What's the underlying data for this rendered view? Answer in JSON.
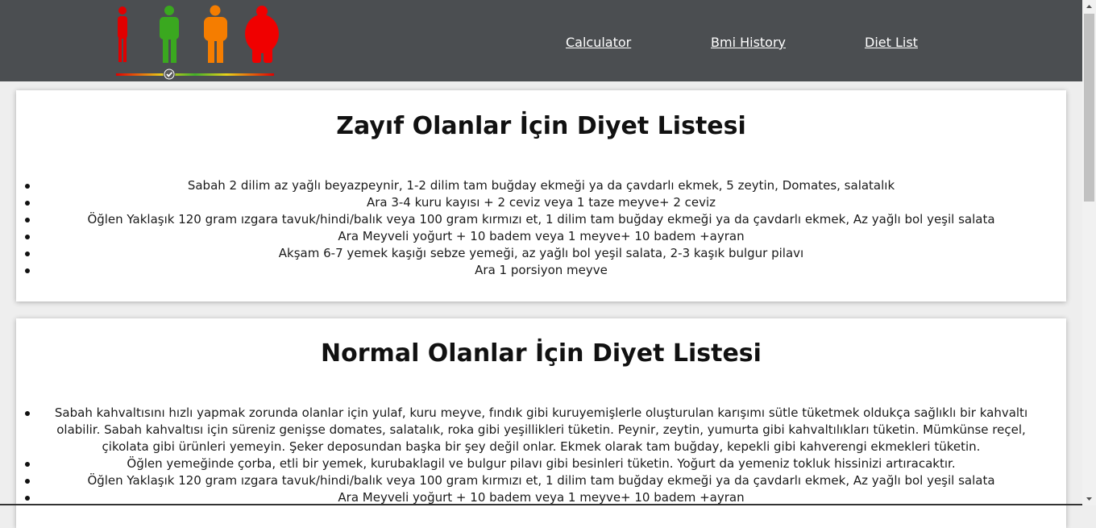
{
  "nav": {
    "links": [
      "Calculator",
      "Bmi History",
      "Diet List"
    ]
  },
  "logo": {
    "figures": [
      "#e00000",
      "#3aa81f",
      "#f57d00",
      "#f00000"
    ]
  },
  "sections": [
    {
      "title": "Zayıf Olanlar İçin Diyet Listesi",
      "items": [
        "Sabah 2 dilim az yağlı beyazpeynir, 1-2 dilim tam buğday ekmeği ya da çavdarlı ekmek, 5 zeytin, Domates, salatalık",
        "Ara 3-4 kuru kayısı + 2 ceviz veya 1 taze meyve+ 2 ceviz",
        "Öğlen Yaklaşık 120 gram ızgara tavuk/hindi/balık veya 100 gram kırmızı et, 1 dilim tam buğday ekmeği ya da çavdarlı ekmek, Az yağlı bol yeşil salata",
        "Ara Meyveli yoğurt + 10 badem veya 1 meyve+ 10 badem +ayran",
        "Akşam 6-7 yemek kaşığı sebze yemeği, az yağlı bol yeşil salata, 2-3 kaşık bulgur pilavı",
        "Ara 1 porsiyon meyve"
      ]
    },
    {
      "title": "Normal Olanlar İçin Diyet Listesi",
      "items": [
        "Sabah kahvaltısını hızlı yapmak zorunda olanlar için yulaf, kuru meyve, fındık gibi kuruyemişlerle oluşturulan karışımı sütle tüketmek oldukça sağlıklı bir kahvaltı olabilir. Sabah kahvaltısı için süreniz genişse domates, salatalık, roka gibi yeşillikleri tüketin. Peynir, zeytin, yumurta gibi kahvaltılıkları tüketin. Mümkünse reçel, çikolata gibi ürünleri yemeyin. Şeker deposundan başka bir şey değil onlar. Ekmek olarak tam buğday, kepekli gibi kahverengi ekmekleri tüketin.",
        "Öğlen yemeğinde çorba, etli bir yemek, kurubaklagil ve bulgur pilavı gibi besinleri tüketin. Yoğurt da yemeniz tokluk hissinizi artıracaktır.",
        "Öğlen Yaklaşık 120 gram ızgara tavuk/hindi/balık veya 100 gram kırmızı et, 1 dilim tam buğday ekmeği ya da çavdarlı ekmek, Az yağlı bol yeşil salata",
        "Ara Meyveli yoğurt + 10 badem veya 1 meyve+ 10 badem +ayran"
      ]
    }
  ]
}
